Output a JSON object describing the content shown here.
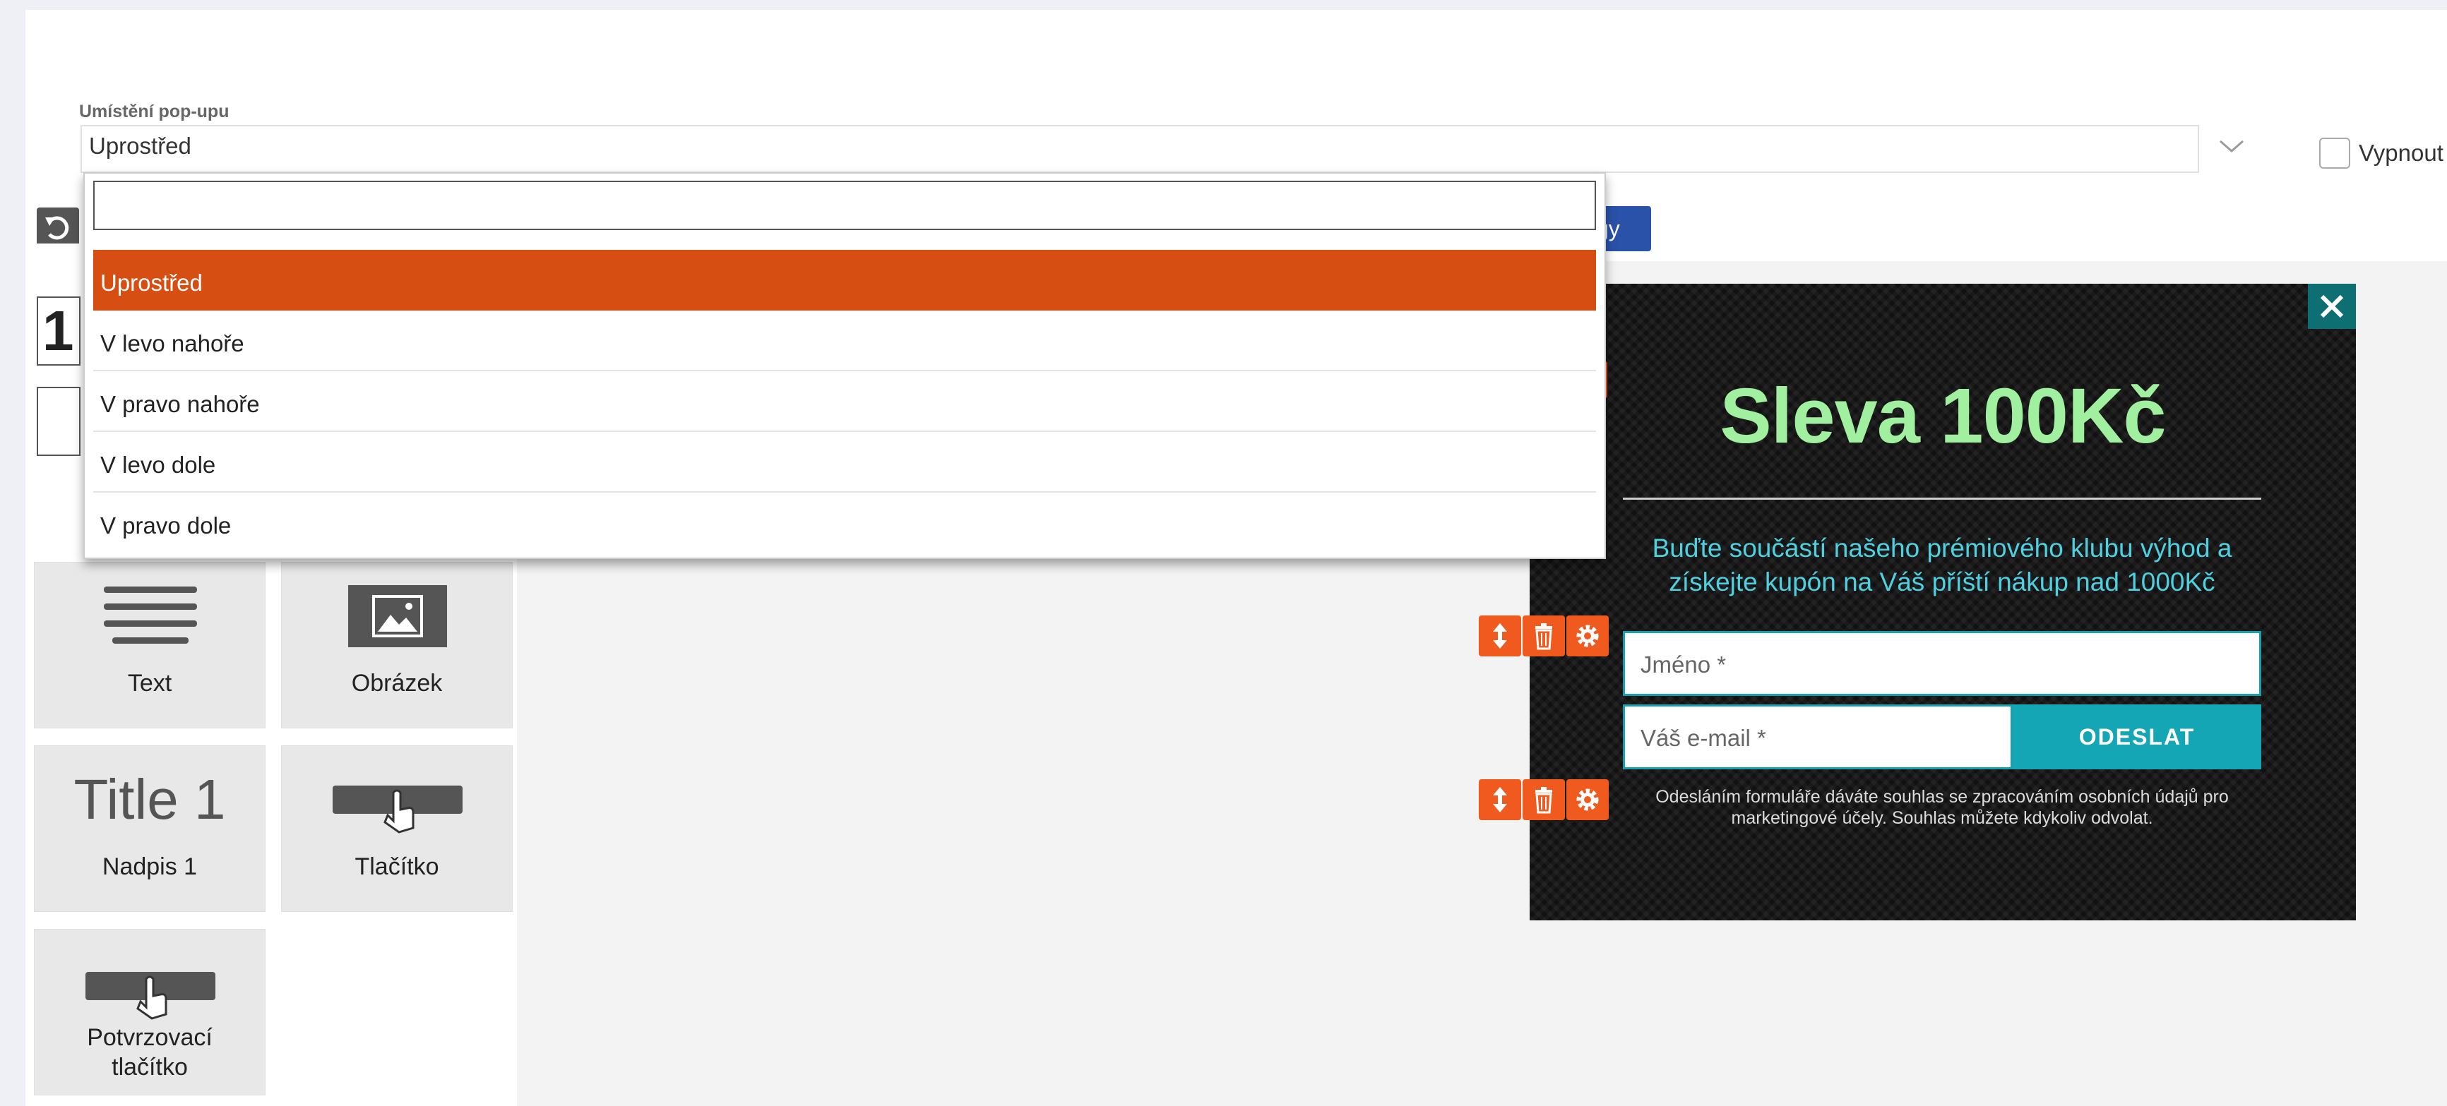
{
  "settings": {
    "placement_label": "Umístění pop-upu",
    "placement_value": "Uprostřed",
    "disable_label": "Vypnout",
    "blue_button_partial": "gy"
  },
  "dropdown": {
    "search_value": "",
    "options": [
      "Uprostřed",
      "V levo nahoře",
      "V pravo nahoře",
      "V levo dole",
      "V pravo dole"
    ],
    "selected_index": 0,
    "selected_color": "#d64e12"
  },
  "palette": {
    "number_box_text": "1",
    "tiles": [
      {
        "label": "Text",
        "icon": "text-lines-icon"
      },
      {
        "label": "Obrázek",
        "icon": "image-icon"
      },
      {
        "label": "Nadpis 1",
        "preview": "Title 1",
        "icon": "heading-icon"
      },
      {
        "label": "Tlačítko",
        "icon": "button-pointer-icon"
      },
      {
        "label": "Potvrzovací tlačítko",
        "icon": "confirm-button-pointer-icon"
      }
    ]
  },
  "popup": {
    "title": "Sleva 100Kč",
    "subtitle": "Buďte součástí našeho prémiového klubu výhod a získejte kupón na Váš příští nákup nad 1000Kč",
    "name_placeholder": "Jméno *",
    "email_placeholder": "Váš e-mail *",
    "submit_label": "ODESLAT",
    "consent_text": "Odesláním formuláře dáváte souhlas se zpracováním osobních údajů pro marketingové účely. Souhlas můžete kdykoliv odvolat.",
    "colors": {
      "title": "#a0f0a0",
      "subtitle": "#4fd0e0",
      "accent": "#14a6b4",
      "control": "#f05a1e"
    }
  }
}
